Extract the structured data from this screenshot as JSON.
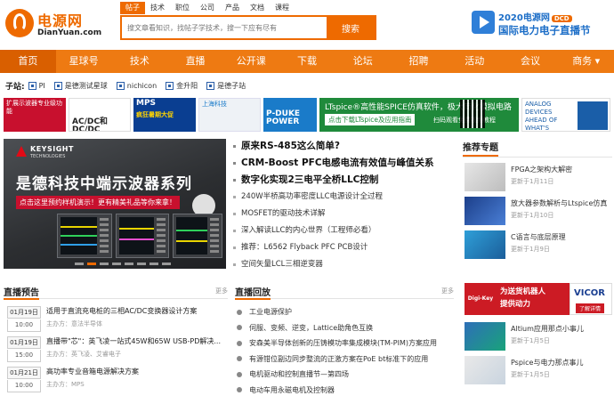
{
  "logo": {
    "cn": "电源网",
    "en": "DianYuan.com"
  },
  "search": {
    "tabs": [
      "帖子",
      "技术",
      "职位",
      "公司",
      "产品",
      "文档",
      "课程"
    ],
    "active_tab": 0,
    "placeholder": "搜文章看知识，找帖子学技术，搜一下应有尽有",
    "button": "搜索"
  },
  "promo": {
    "line1": "2020电源网",
    "badge": "DCD",
    "line2": "国际电力电子直播节"
  },
  "nav": {
    "items": [
      "首页",
      "星球号",
      "技术",
      "直播",
      "公开课",
      "下载",
      "论坛",
      "招聘",
      "活动",
      "会议",
      "商务 ▾"
    ],
    "active": 0
  },
  "subsites": {
    "label": "子站:",
    "items": [
      "PI",
      "是德测试星球",
      "nichicon",
      "金升阳",
      "是德子站"
    ]
  },
  "ads": {
    "ad1": "扩展示波器专业级功能",
    "ad2": "AC/DC和DC/DC",
    "ad3_title": "MPS",
    "ad3_text": "疯狂暑期大促",
    "ad4": "上海科技",
    "ad5": "P-DUKE POWER",
    "ad6_title": "LTspice®高性能SPICE仿真软件，极大简化模拟电路仿真",
    "ad6_sub": "点击下载LTspice及应用指南",
    "ad6_sub2": "扫码观看免费视频教程",
    "ad7": "ANALOG DEVICES AHEAD OF WHAT'S POSSIBLE"
  },
  "banner": {
    "brand": "KEYSIGHT",
    "brand_sub": "TECHNOLOGIES",
    "title": "是德科技中端示波器系列",
    "sub": "点击这里预约样机演示！更有精美礼品等你来拿！",
    "slides": 8,
    "active_slide": 1
  },
  "headlines": {
    "big": [
      "原来RS-485这么简单?",
      "CRM-Boost PFC电感电流有效值与峰值关系",
      "数字化实现2三电平全桥LLC控制"
    ],
    "items": [
      "240W半桥高功率密度LLC电源设计全过程",
      "MOSFET的驱动技术详解",
      "深入解读LLC的内心世界（工程师必看）",
      "推荐：L6562 Flyback PFC PCB设计",
      "空间矢量LCL三相逆变器"
    ]
  },
  "recommend": {
    "title": "推荐专题",
    "items": [
      {
        "title": "FPGA之架构大解密",
        "date": "更新于1月11日"
      },
      {
        "title": "放大器参数解析与Ltspice仿真",
        "date": "更新于1月10日"
      },
      {
        "title": "C语言与底层原理",
        "date": "更新于1月9日"
      }
    ]
  },
  "live": {
    "title": "直播预告",
    "more": "更多",
    "items": [
      {
        "date": "01月19日",
        "time": "10:00",
        "title": "适用于直流充电桩的三相AC/DC变换器设计方案",
        "host": "主办方：意法半导体"
      },
      {
        "date": "01月19日",
        "time": "15:00",
        "title": "直播带\"芯\"：英飞凌一站式45W和65W USB-PD解决...",
        "host": "主办方：英飞凌、艾睿电子"
      },
      {
        "date": "01月21日",
        "time": "10:00",
        "title": "高功率专业音箱电源解决方案",
        "host": "主办方：MPS"
      }
    ]
  },
  "replay": {
    "title": "直播回放",
    "more": "更多",
    "items": [
      "工业电源保护",
      "伺服、变频、逆变，Lattice助角色互换",
      "安森美半导体创新的压铸模功率集成模块(TM-PIM)方案应用",
      "有源钳位副边同步整流的正激方案在PoE bt标准下的应用",
      "电机驱动和控制直播节—第四场",
      "电动车用永磁电机及控制器"
    ]
  },
  "ad_digi": {
    "logo": "Digi-Key",
    "text1": "为送货机器人",
    "text2": "提供动力",
    "vicor": "VICOR",
    "vicor_btn": "了解详情"
  },
  "recommend2": {
    "items": [
      {
        "title": "Altium应用那点小事儿",
        "date": "更新于1月5日"
      },
      {
        "title": "Pspice与电力那点事儿",
        "date": "更新于1月5日"
      }
    ]
  },
  "colors": {
    "brand": "#ee6a00",
    "nav": "#ee7a12",
    "nav_active": "#d95f00"
  }
}
